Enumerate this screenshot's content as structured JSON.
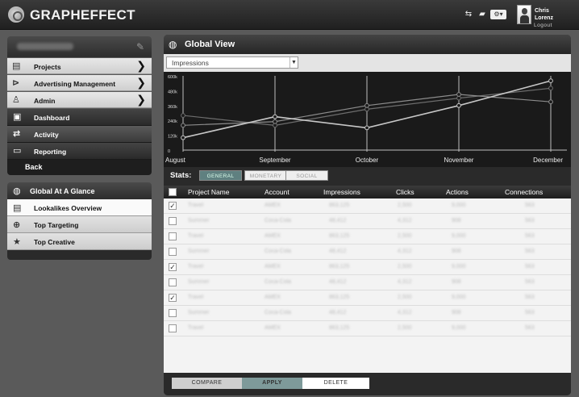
{
  "app": {
    "name": "GRAPHEFFECT"
  },
  "user": {
    "first": "Chris",
    "last": "Lorenz",
    "logout": "Logout"
  },
  "sidebar": {
    "items": [
      {
        "label": "Projects",
        "icon": "document-icon"
      },
      {
        "label": "Advertising Management",
        "icon": "tag-icon"
      },
      {
        "label": "Admin",
        "icon": "person-icon"
      }
    ],
    "dark_items": [
      {
        "label": "Dashboard",
        "icon": "briefcase-icon"
      },
      {
        "label": "Activity",
        "icon": "arrows-icon"
      },
      {
        "label": "Reporting",
        "icon": "id-card-icon"
      }
    ],
    "back_label": "Back",
    "glance": {
      "title": "Global At A Glance",
      "items": [
        {
          "label": "Lookalikes Overview",
          "icon": "people-icon"
        },
        {
          "label": "Top Targeting",
          "icon": "target-icon"
        },
        {
          "label": "Top Creative",
          "icon": "star-icon"
        }
      ]
    }
  },
  "main": {
    "title": "Global View",
    "select_value": "Impressions",
    "stats_label": "Stats:",
    "stat_tabs": [
      "GENERAL",
      "MONETARY",
      "SOCIAL"
    ],
    "columns": [
      "Project Name",
      "Account",
      "Impressions",
      "Clicks",
      "Actions",
      "Connections"
    ],
    "rows": [
      {
        "checked": true,
        "cells": [
          "Travel",
          "AMEX",
          "863,125",
          "2,500",
          "9,000",
          "563"
        ]
      },
      {
        "checked": false,
        "cells": [
          "Summer",
          "Coca-Cola",
          "48,412",
          "4,312",
          "908",
          "563"
        ]
      },
      {
        "checked": false,
        "cells": [
          "Travel",
          "AMEX",
          "863,125",
          "2,500",
          "9,000",
          "563"
        ]
      },
      {
        "checked": false,
        "cells": [
          "Summer",
          "Coca-Cola",
          "48,412",
          "4,312",
          "908",
          "563"
        ]
      },
      {
        "checked": true,
        "cells": [
          "Travel",
          "AMEX",
          "863,125",
          "2,500",
          "9,000",
          "563"
        ]
      },
      {
        "checked": false,
        "cells": [
          "Summer",
          "Coca-Cola",
          "48,412",
          "4,312",
          "908",
          "563"
        ]
      },
      {
        "checked": true,
        "cells": [
          "Travel",
          "AMEX",
          "863,125",
          "2,500",
          "9,000",
          "563"
        ]
      },
      {
        "checked": false,
        "cells": [
          "Summer",
          "Coca-Cola",
          "48,412",
          "4,312",
          "908",
          "563"
        ]
      },
      {
        "checked": false,
        "cells": [
          "Travel",
          "AMEX",
          "863,125",
          "2,500",
          "9,000",
          "563"
        ]
      }
    ],
    "footer_buttons": [
      "COMPARE",
      "APPLY",
      "DELETE"
    ]
  },
  "chart_data": {
    "type": "line",
    "categories": [
      "August",
      "September",
      "October",
      "November",
      "December"
    ],
    "y_ticks": [
      "600k",
      "480k",
      "360k",
      "240k",
      "120k",
      "0"
    ],
    "ylim": [
      0,
      600000
    ],
    "series": [
      {
        "values": [
          100000,
          270000,
          180000,
          360000,
          560000
        ]
      },
      {
        "values": [
          200000,
          230000,
          360000,
          450000,
          390000
        ]
      },
      {
        "values": [
          280000,
          200000,
          330000,
          420000,
          500000
        ]
      }
    ]
  }
}
